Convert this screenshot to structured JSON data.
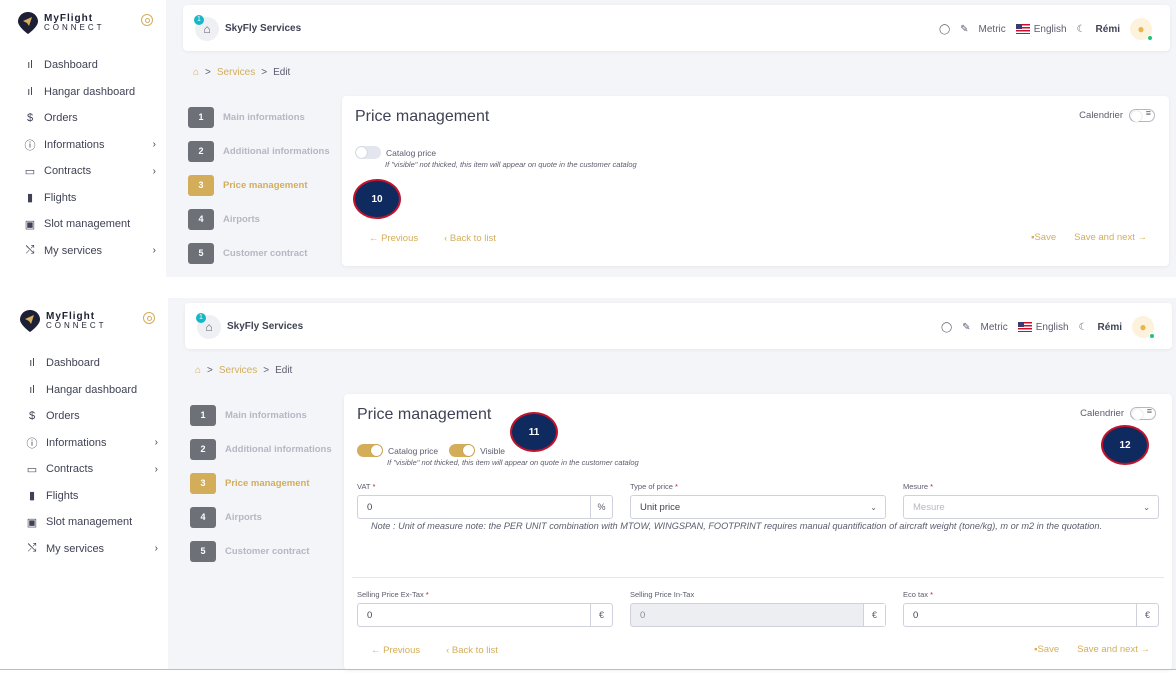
{
  "brand": {
    "line1": "MyFlight",
    "line2": "CONNECT"
  },
  "nav": [
    {
      "icon": "ıl",
      "label": "Dashboard",
      "chev": ""
    },
    {
      "icon": "ıl",
      "label": "Hangar dashboard",
      "chev": ""
    },
    {
      "icon": "$",
      "label": "Orders",
      "chev": ""
    },
    {
      "icon": "ⓘ",
      "label": "Informations",
      "chev": "›"
    },
    {
      "icon": "▭",
      "label": "Contracts",
      "chev": "›"
    },
    {
      "icon": "▮",
      "label": "Flights",
      "chev": ""
    },
    {
      "icon": "▣",
      "label": "Slot management",
      "chev": ""
    },
    {
      "icon": "⤭",
      "label": "My services",
      "chev": "›"
    }
  ],
  "topbar": {
    "badge": "1",
    "company": "SkyFly Services",
    "unit": "Metric",
    "language": "English",
    "user": "Rémi"
  },
  "breadcrumb": {
    "services": "Services",
    "edit": "Edit",
    "sep": ">"
  },
  "steps": [
    {
      "num": "1",
      "label": "Main informations"
    },
    {
      "num": "2",
      "label": "Additional informations"
    },
    {
      "num": "3",
      "label": "Price management"
    },
    {
      "num": "4",
      "label": "Airports"
    },
    {
      "num": "5",
      "label": "Customer contract"
    }
  ],
  "card": {
    "title": "Price management",
    "calendar": "Calendrier",
    "catalog_price": "Catalog price",
    "visible": "Visible",
    "hint": "If \"visible\" not thicked, this item will appear on quote in the customer catalog",
    "previous": "Previous",
    "back": "Back to list",
    "save": "Save",
    "save_next": "Save and next"
  },
  "form": {
    "vat_label": "VAT",
    "vat_value": "0",
    "vat_suffix": "%",
    "type_label": "Type of price",
    "type_value": "Unit price",
    "mesure_label": "Mesure",
    "mesure_placeholder": "Mesure",
    "note": "Note : Unit of measure note: the PER UNIT combination with MTOW, WINGSPAN, FOOTPRINT requires manual quantification of aircraft weight (tone/kg), m or m2 in the quotation.",
    "ex_tax_label": "Selling Price Ex-Tax",
    "ex_tax_value": "0",
    "in_tax_label": "Selling Price In-Tax",
    "in_tax_value": "0",
    "eco_label": "Eco tax",
    "eco_value": "0",
    "currency": "€",
    "req": "*"
  },
  "markers": {
    "m10": "10",
    "m11": "11",
    "m12": "12"
  },
  "colors": {
    "accent": "#d4ad5a",
    "marker_fill": "#0e2a5e",
    "marker_border": "#c0142c",
    "online": "#1bc47d"
  }
}
